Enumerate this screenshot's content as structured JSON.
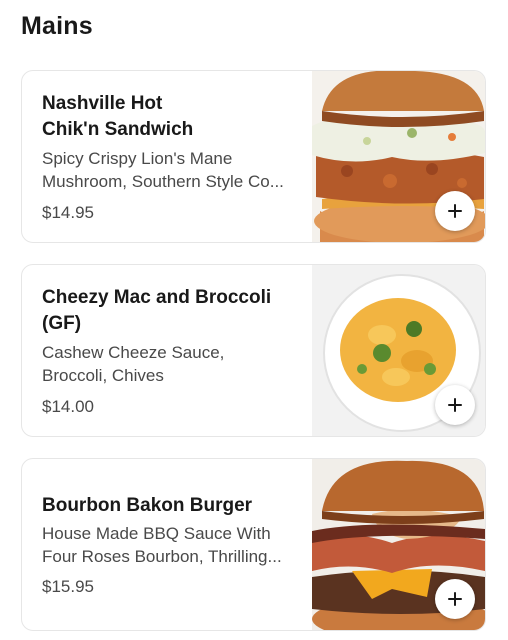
{
  "section": {
    "title": "Mains"
  },
  "items": [
    {
      "name": "Nashville Hot\nChik'n Sandwich",
      "description": "Spicy Crispy Lion's Mane\nMushroom, Southern Style Co...",
      "price": "$14.95",
      "image_icon": "sandwich-photo"
    },
    {
      "name": "Cheezy Mac and Broccoli\n(GF)",
      "description": "Cashew Cheeze Sauce,\nBroccoli, Chives",
      "price": "$14.00",
      "image_icon": "mac-and-cheese-photo"
    },
    {
      "name": "Bourbon Bakon Burger",
      "description": "House Made BBQ Sauce With\nFour Roses Bourbon, Thrilling...",
      "price": "$15.95",
      "image_icon": "burger-photo"
    }
  ],
  "colors": {
    "text_primary": "#191919",
    "text_secondary": "#494949",
    "card_border": "#e6e6e6"
  }
}
